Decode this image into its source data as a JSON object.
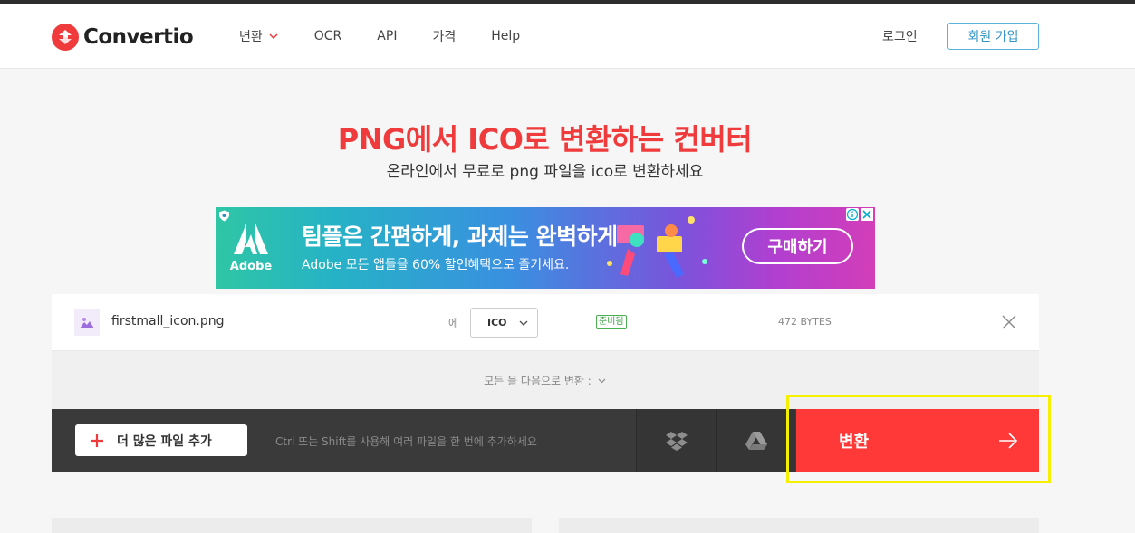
{
  "header": {
    "logo_text": "Convertio",
    "nav": [
      {
        "label": "변환",
        "has_dropdown": true
      },
      {
        "label": "OCR"
      },
      {
        "label": "API"
      },
      {
        "label": "가격"
      },
      {
        "label": "Help"
      }
    ],
    "login_label": "로그인",
    "signup_label": "회원 가입"
  },
  "hero": {
    "title": "PNG에서 ICO로 변환하는 컨버터",
    "subtitle": "온라인에서 무료로 png 파일을 ico로 변환하세요"
  },
  "ad": {
    "brand": "Adobe",
    "headline": "팀플은 간편하게, 과제는 완벽하게",
    "body": "Adobe 모든 앱들을 60% 할인혜택으로 즐기세요.",
    "cta": "구매하기"
  },
  "converter": {
    "file": {
      "name": "firstmall_icon.png",
      "to_label": "에",
      "format": "ICO",
      "status": "준비됨",
      "size": "472 BYTES"
    },
    "convert_all_label": "모든 을 다음으로 변환 :",
    "add_more_label": "더 많은 파일 추가",
    "hint": "Ctrl 또는 Shift를 사용해 여러 파일을 한 번에 추가하세요",
    "convert_label": "변환"
  },
  "colors": {
    "accent_red": "#ff3838",
    "title_red": "#ef3b3b",
    "signup_blue": "#3696c7",
    "status_green": "#3a9f3e",
    "highlight_yellow": "#f5f000"
  }
}
